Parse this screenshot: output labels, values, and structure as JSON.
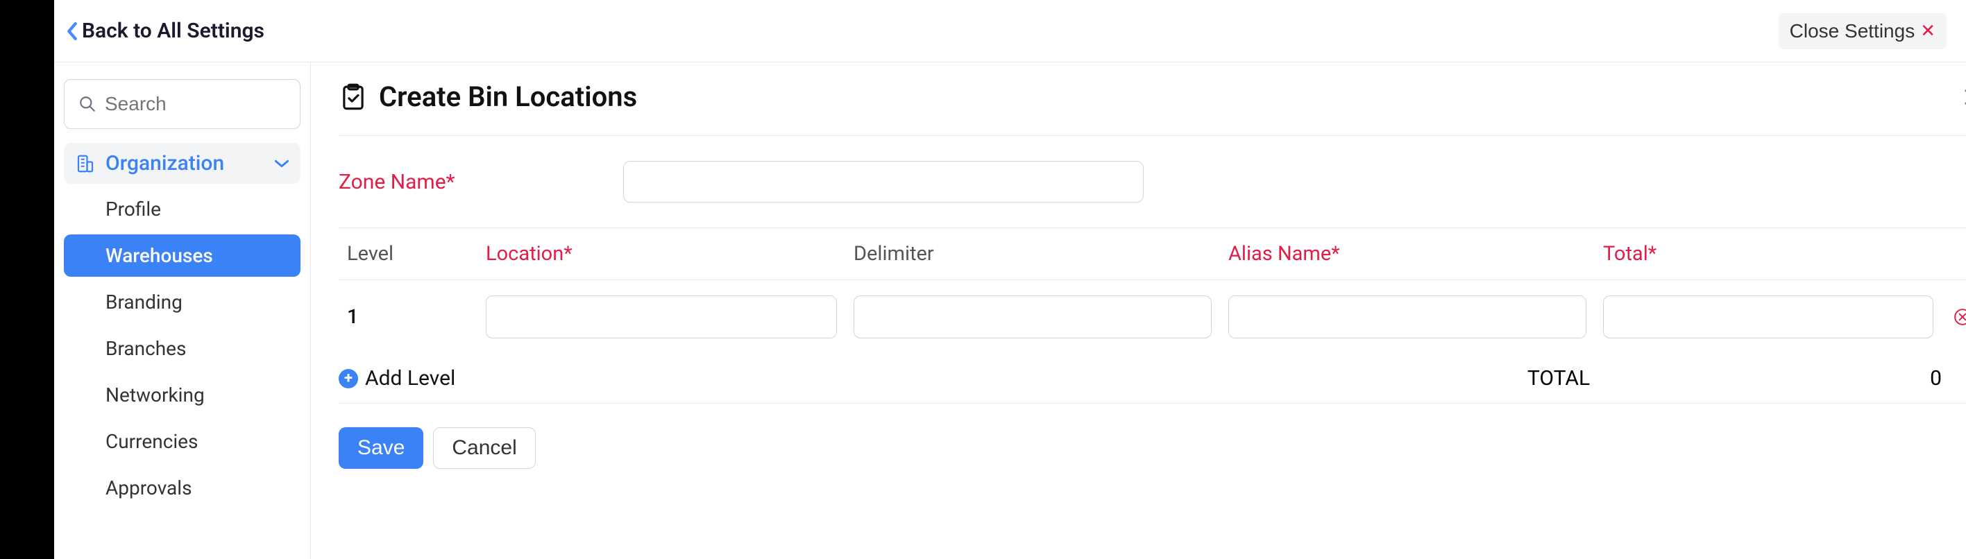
{
  "header": {
    "back_label": "Back to All Settings",
    "close_label": "Close Settings"
  },
  "sidebar": {
    "search_placeholder": "Search",
    "group_label": "Organization",
    "items": [
      {
        "label": "Profile"
      },
      {
        "label": "Warehouses"
      },
      {
        "label": "Branding"
      },
      {
        "label": "Branches"
      },
      {
        "label": "Networking"
      },
      {
        "label": "Currencies"
      },
      {
        "label": "Approvals"
      }
    ]
  },
  "main": {
    "title": "Create Bin Locations",
    "zone_label": "Zone Name*",
    "zone_value": "",
    "columns": {
      "level": "Level",
      "location": "Location*",
      "delimiter": "Delimiter",
      "alias": "Alias Name*",
      "total": "Total*"
    },
    "rows": [
      {
        "level": "1",
        "location": "",
        "delimiter": "",
        "alias": "",
        "total": ""
      }
    ],
    "add_level_label": "Add Level",
    "footer_total_label": "TOTAL",
    "footer_total_value": "0",
    "save_label": "Save",
    "cancel_label": "Cancel"
  }
}
